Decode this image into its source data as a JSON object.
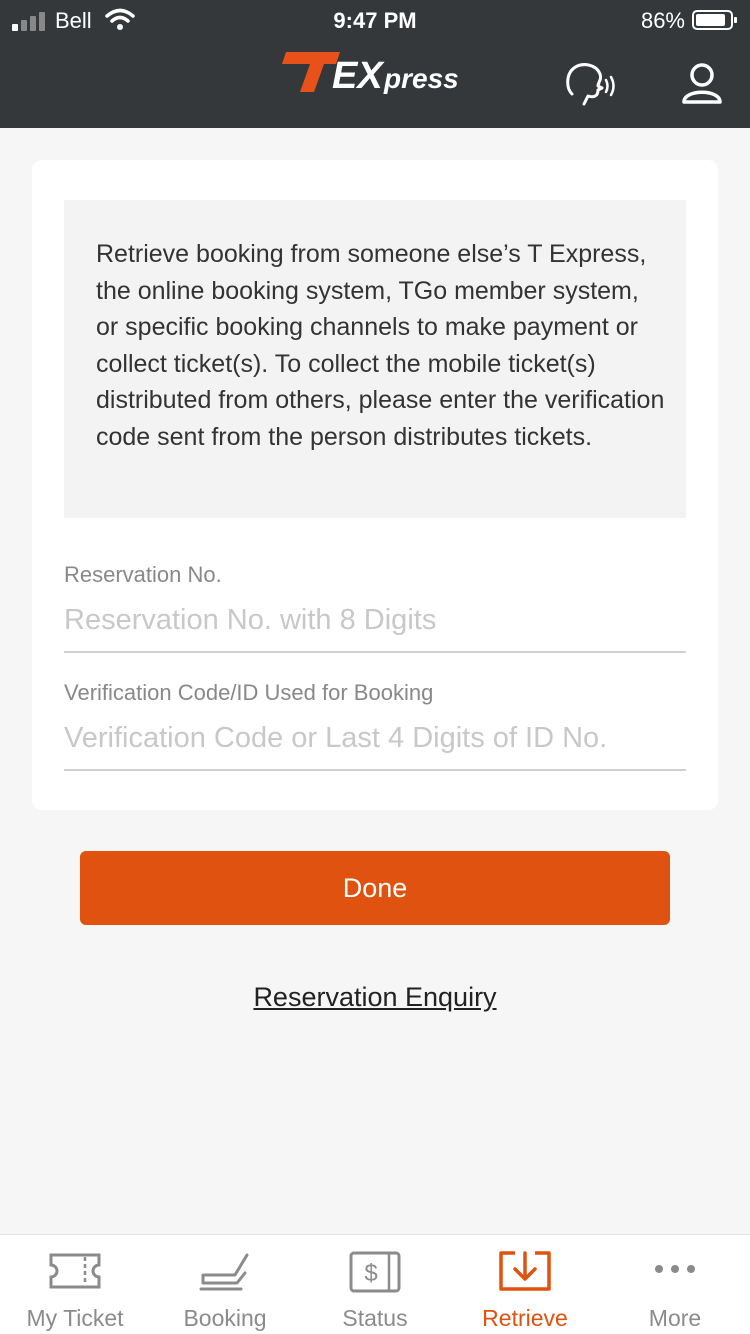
{
  "status_bar": {
    "carrier": "Bell",
    "time": "9:47 PM",
    "battery": "86%"
  },
  "header": {
    "logo_text": "TEXpress",
    "voice_icon": "voice-assist-icon",
    "user_icon": "user-icon"
  },
  "info_box": {
    "text": "Retrieve booking from someone else’s T Express, the online booking system, TGo member system, or specific booking channels to make payment or collect ticket(s). To collect the mobile ticket(s) distributed from others, please enter the verification code sent from the person distributes tickets."
  },
  "form": {
    "reservation_label": "Reservation No.",
    "reservation_placeholder": "Reservation No. with 8 Digits",
    "verification_label": "Verification Code/ID Used for Booking",
    "verification_placeholder": "Verification Code or Last 4 Digits of ID No."
  },
  "actions": {
    "done_label": "Done",
    "enquiry_label": "Reservation Enquiry"
  },
  "tabs": [
    {
      "label": "My Ticket",
      "icon": "ticket-icon",
      "active": false
    },
    {
      "label": "Booking",
      "icon": "seat-icon",
      "active": false
    },
    {
      "label": "Status",
      "icon": "status-dollar-icon",
      "active": false
    },
    {
      "label": "Retrieve",
      "icon": "retrieve-download-icon",
      "active": true
    },
    {
      "label": "More",
      "icon": "more-dots-icon",
      "active": false
    }
  ],
  "colors": {
    "accent": "#e0520f",
    "header_bg": "#35383b",
    "tab_inactive": "#8b8b8b"
  }
}
